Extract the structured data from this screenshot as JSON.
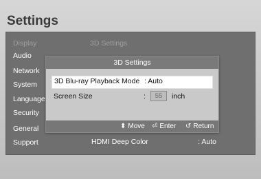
{
  "title": "Settings",
  "menu": [
    {
      "label": "Display",
      "dim": true
    },
    {
      "label": "Audio",
      "dim": false
    },
    {
      "label": "Network",
      "dim": false
    },
    {
      "label": "System",
      "dim": false
    },
    {
      "label": "Language",
      "dim": false
    },
    {
      "label": "Security",
      "dim": false
    },
    {
      "label": "General",
      "dim": false
    },
    {
      "label": "Support",
      "dim": false
    }
  ],
  "display_header": "3D Settings",
  "hdmi": {
    "label": "HDMI Deep Color",
    "value": ": Auto"
  },
  "dialog": {
    "title": "3D Settings",
    "blu_ray": {
      "label": "3D Blu-ray Playback Mode",
      "value": ": Auto"
    },
    "screen": {
      "label": "Screen Size",
      "colon": ":",
      "value": "55",
      "unit": "inch"
    },
    "footer": {
      "move": {
        "icon": "up-down-arrows-icon",
        "label": "Move"
      },
      "enter": {
        "icon": "enter-icon",
        "label": "Enter"
      },
      "return": {
        "icon": "return-icon",
        "label": "Return"
      }
    }
  }
}
